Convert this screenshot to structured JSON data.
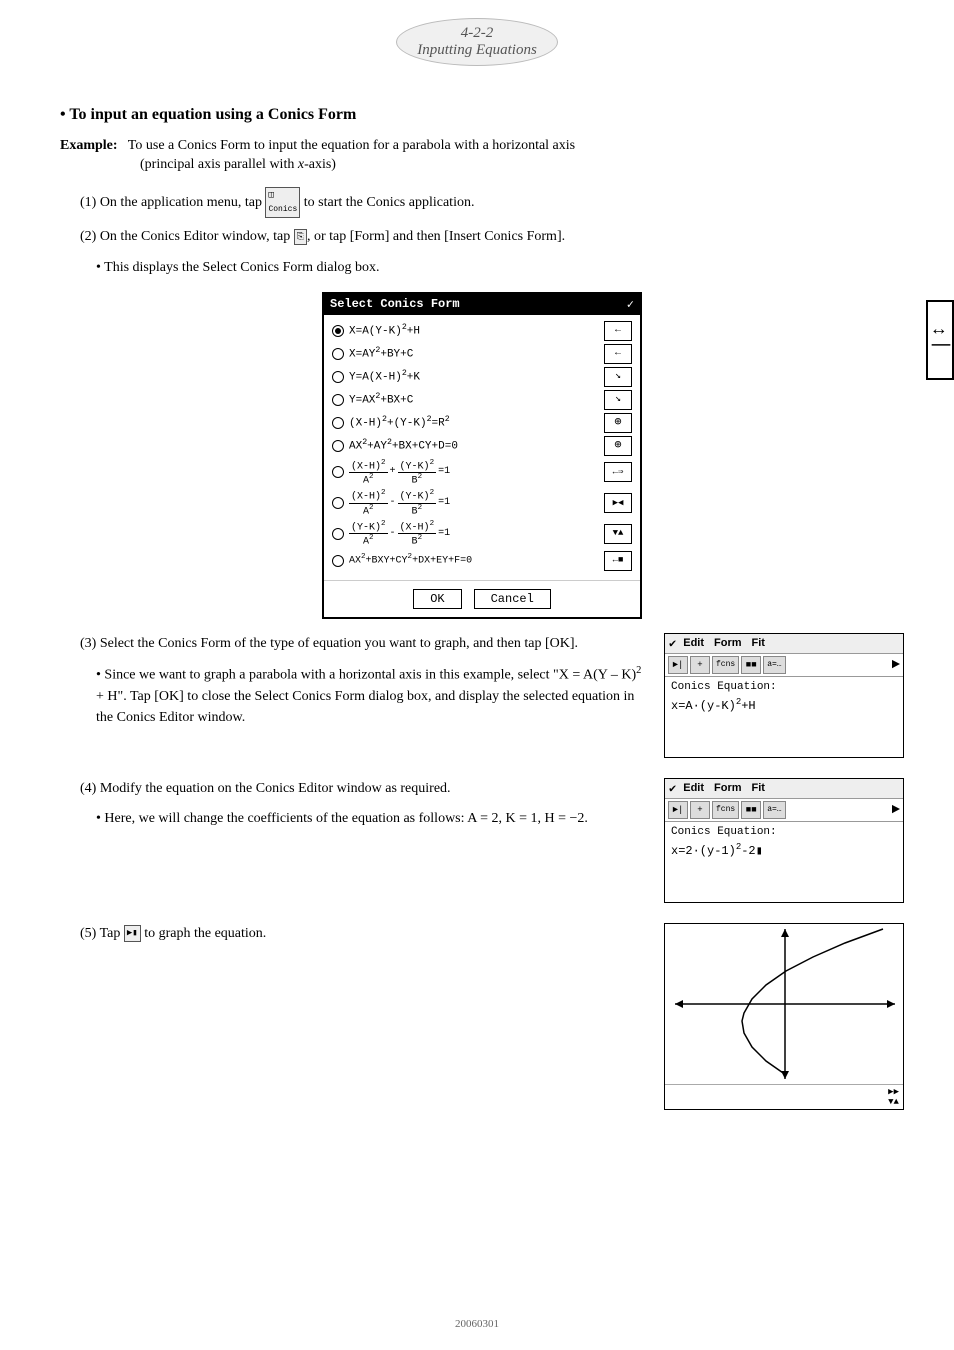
{
  "header": {
    "page_ref": "4-2-2",
    "subtitle": "Inputting Equations"
  },
  "section": {
    "heading": "To input an equation using a Conics Form"
  },
  "example": {
    "label": "Example:",
    "text": "To use a Conics Form to input the equation for a parabola with a horizontal axis",
    "text2": "(principal axis parallel with x-axis)"
  },
  "steps": [
    {
      "id": "step1",
      "text": "(1) On the application menu, tap   to start the Conics application."
    },
    {
      "id": "step2",
      "text": "(2) On the Conics Editor window, tap  , or tap [Form] and then [Insert Conics Form]."
    },
    {
      "id": "step2b",
      "text": "This displays the Select Conics Form dialog box."
    },
    {
      "id": "step3",
      "text": "(3) Select the Conics Form of the type of equation you want to graph, and then tap [OK]."
    },
    {
      "id": "step3b",
      "text": "Since we want to graph a parabola with a horizontal axis in this example, select \"X = A(Y – K)² + H\". Tap [OK] to close the Select Conics Form dialog box, and display the selected equation in the Conics Editor window."
    },
    {
      "id": "step4",
      "text": "(4) Modify the equation on the Conics Editor window as required."
    },
    {
      "id": "step4b",
      "text": "Here, we will change the coefficients of the equation as follows: A = 2, K = 1, H = −2."
    },
    {
      "id": "step5",
      "text": "(5) Tap   to graph the equation."
    }
  ],
  "dialog": {
    "title": "Select  Conics  Form",
    "close_icon": "×",
    "equations": [
      {
        "selected": true,
        "text": "X=A(Y-K)²+H"
      },
      {
        "selected": false,
        "text": "X=AY²+BY+C"
      },
      {
        "selected": false,
        "text": "Y=A(X-H)²+K"
      },
      {
        "selected": false,
        "text": "Y=AX²+BX+C"
      },
      {
        "selected": false,
        "text": "(X-H)²+(Y-K)²=R²"
      },
      {
        "selected": false,
        "text": "AX²+AY²+BX+CY+D=0"
      },
      {
        "selected": false,
        "text_frac": true,
        "num1": "(X-H)²",
        "den1": "A²",
        "num2": "(Y-K)²",
        "den2": "B²",
        "sign": "+",
        "eq": "=1"
      },
      {
        "selected": false,
        "text_frac2": true,
        "num1": "(X-H)²",
        "den1": "A²",
        "num2": "(Y-K)²",
        "den2": "B²",
        "sign": "-",
        "eq": "=1"
      },
      {
        "selected": false,
        "text_frac3": true,
        "num1": "(Y-K)²",
        "den1": "A²",
        "num2": "(X-H)²",
        "den2": "B²",
        "sign": "-",
        "eq": "=1"
      },
      {
        "selected": false,
        "text": "AX²+BXY+CY²+DX+EY+F=0"
      }
    ],
    "ok_label": "OK",
    "cancel_label": "Cancel"
  },
  "editor1": {
    "menu": [
      "Edit",
      "Form",
      "Fit"
    ],
    "toolbar_btns": [
      "►|",
      "+",
      "•",
      "fcns",
      "■■",
      "a=..."
    ],
    "label": "Conics Equation:",
    "equation": "x=A·(y-K)²+H"
  },
  "editor2": {
    "menu": [
      "Edit",
      "Form",
      "Fit"
    ],
    "toolbar_btns": [
      "►|",
      "+",
      "•",
      "fcns",
      "■■",
      "a=..."
    ],
    "label": "Conics Equation:",
    "equation": "x=2·(y-1)²-2"
  },
  "footer": {
    "code": "20060301"
  }
}
